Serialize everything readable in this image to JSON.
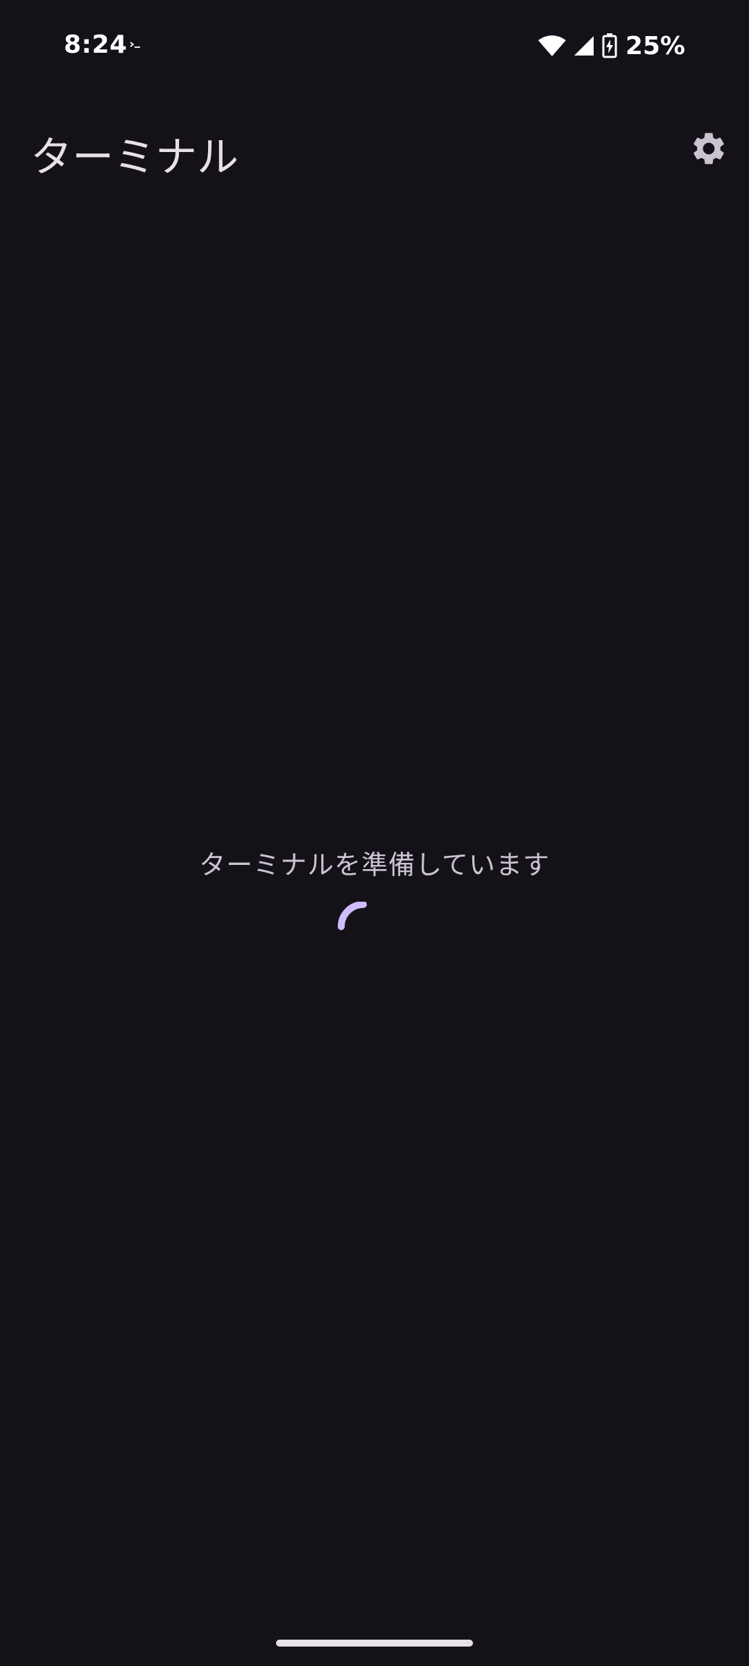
{
  "status_bar": {
    "time": "8:24",
    "battery": "25%",
    "icons": [
      "terminal-icon",
      "wifi-icon",
      "cell-signal-icon",
      "battery-charging-icon"
    ]
  },
  "app_bar": {
    "title": "ターミナル",
    "settings_icon": "gear-icon"
  },
  "main": {
    "loading_text": "ターミナルを準備しています"
  },
  "colors": {
    "background": "#141218",
    "accent": "#D0BCFF",
    "text_primary": "#E6E0E9",
    "text_secondary": "#CAC4D0"
  }
}
